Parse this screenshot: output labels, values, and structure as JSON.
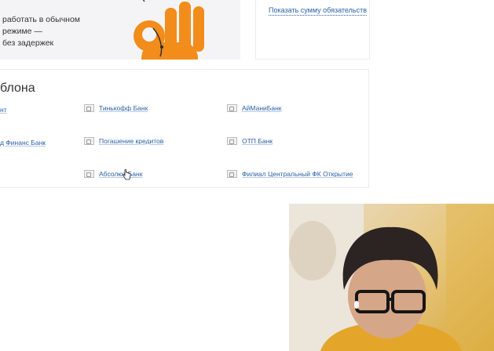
{
  "promo": {
    "text": "работать в обычном режиме —\nбез задержек"
  },
  "side": {
    "show_sum_link": "Показать сумму обязательств"
  },
  "banks_section": {
    "title": "блона",
    "col1": [
      "нт",
      "д Финанс Банк"
    ],
    "col2": [
      "Тинькофф Банк",
      "Погашение кредитов",
      "Абсолют Банк"
    ],
    "col3": [
      "АйМаниБанк",
      "ОТП Банк",
      "Филиал Центральный ФК Открытие"
    ]
  },
  "colors": {
    "link": "#2a61a8",
    "accent_orange": "#f28c1a"
  }
}
